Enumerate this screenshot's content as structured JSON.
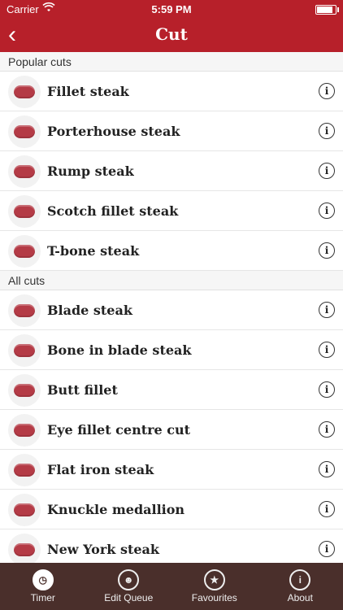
{
  "status": {
    "carrier": "Carrier",
    "time": "5:59 PM",
    "battery_level": 0.95
  },
  "nav": {
    "title": "Cut"
  },
  "sections": [
    {
      "title": "Popular cuts",
      "items": [
        {
          "label": "Fillet steak"
        },
        {
          "label": "Porterhouse steak"
        },
        {
          "label": "Rump steak"
        },
        {
          "label": "Scotch fillet steak"
        },
        {
          "label": "T-bone steak"
        }
      ]
    },
    {
      "title": "All cuts",
      "items": [
        {
          "label": "Blade steak"
        },
        {
          "label": "Bone in blade steak"
        },
        {
          "label": "Butt fillet"
        },
        {
          "label": "Eye fillet centre cut"
        },
        {
          "label": "Flat iron steak"
        },
        {
          "label": "Knuckle medallion"
        },
        {
          "label": "New York steak"
        }
      ]
    }
  ],
  "tabs": [
    {
      "label": "Timer",
      "icon": "timer-icon",
      "active": true
    },
    {
      "label": "Edit Queue",
      "icon": "edit-queue-icon",
      "active": false
    },
    {
      "label": "Favourites",
      "icon": "star-icon",
      "active": false
    },
    {
      "label": "About",
      "icon": "info-icon",
      "active": false
    }
  ],
  "colors": {
    "brand": "#b7202a",
    "tabbar": "#4a2f2b",
    "meat": "#b43b46"
  }
}
